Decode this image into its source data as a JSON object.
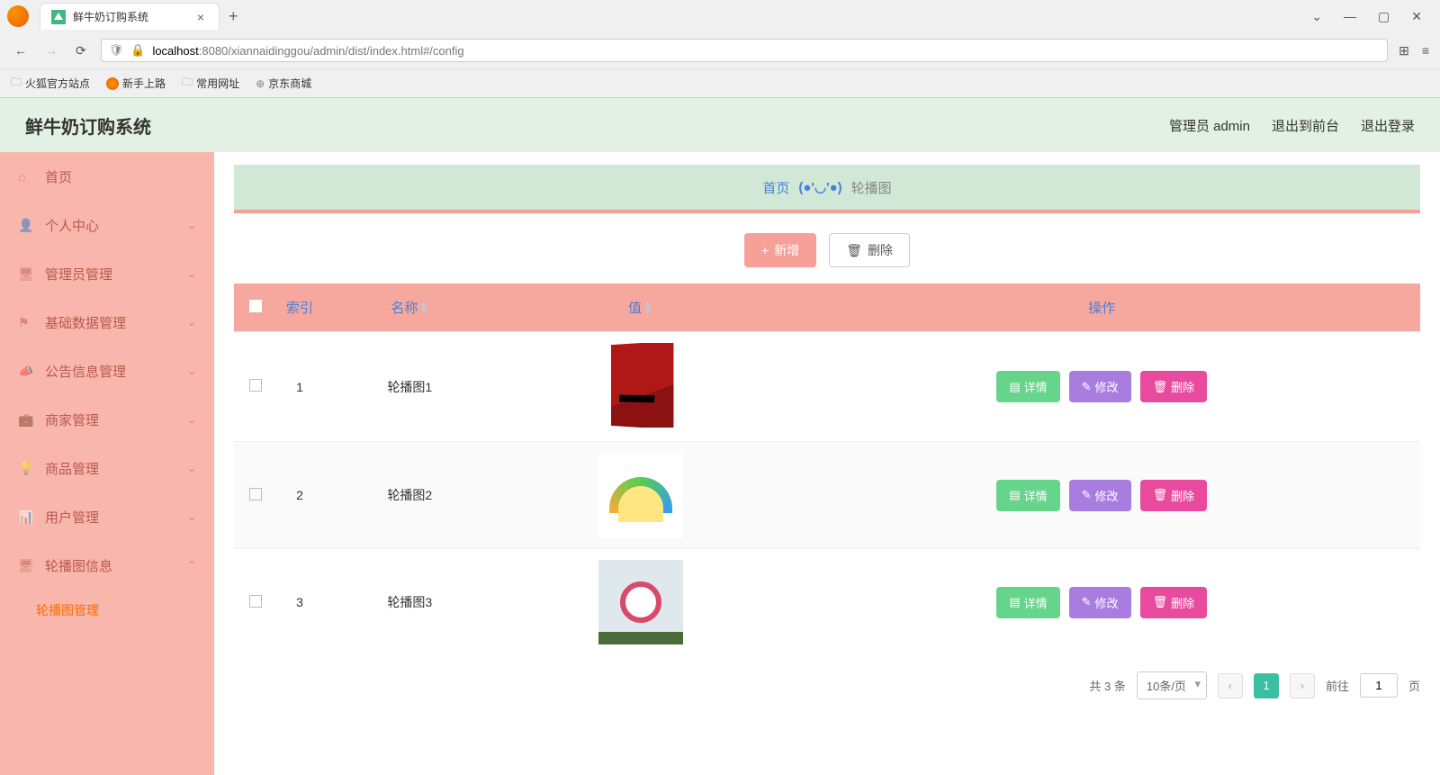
{
  "browser": {
    "tab_title": "鲜牛奶订购系统",
    "new_tab": "+",
    "back": "←",
    "forward": "→",
    "reload": "⟳",
    "url_host": "localhost",
    "url_rest": ":8080/xiannaidinggou/admin/dist/index.html#/config",
    "bookmarks": [
      "火狐官方站点",
      "新手上路",
      "常用网址",
      "京东商城"
    ],
    "win_min": "—",
    "win_max": "▢",
    "win_close": "✕",
    "dropdown": "⌄"
  },
  "header": {
    "title": "鲜牛奶订购系统",
    "admin_label": "管理员 admin",
    "to_front": "退出到前台",
    "logout": "退出登录"
  },
  "sidebar": {
    "items": [
      "首页",
      "个人中心",
      "管理员管理",
      "基础数据管理",
      "公告信息管理",
      "商家管理",
      "商品管理",
      "用户管理",
      "轮播图信息"
    ],
    "sub_item": "轮播图管理"
  },
  "banner": {
    "home": "首页",
    "sep": "(●'◡'●)",
    "current": "轮播图"
  },
  "toolbar": {
    "add_icon": "+",
    "add_label": "新增",
    "del_icon": "🗑",
    "del_label": "删除"
  },
  "table": {
    "headers": {
      "index": "索引",
      "name": "名称",
      "value": "值",
      "action": "操作"
    },
    "rows": [
      {
        "index": "1",
        "name": "轮播图1"
      },
      {
        "index": "2",
        "name": "轮播图2"
      },
      {
        "index": "3",
        "name": "轮播图3"
      }
    ],
    "actions": {
      "detail": "详情",
      "edit": "修改",
      "delete": "删除",
      "detail_icon": "▤",
      "edit_icon": "✎",
      "delete_icon": "🗑"
    }
  },
  "pagination": {
    "total": "共 3 条",
    "per_page": "10条/页",
    "prev": "‹",
    "page": "1",
    "next": "›",
    "goto_prefix": "前往",
    "goto_value": "1",
    "goto_suffix": "页"
  }
}
